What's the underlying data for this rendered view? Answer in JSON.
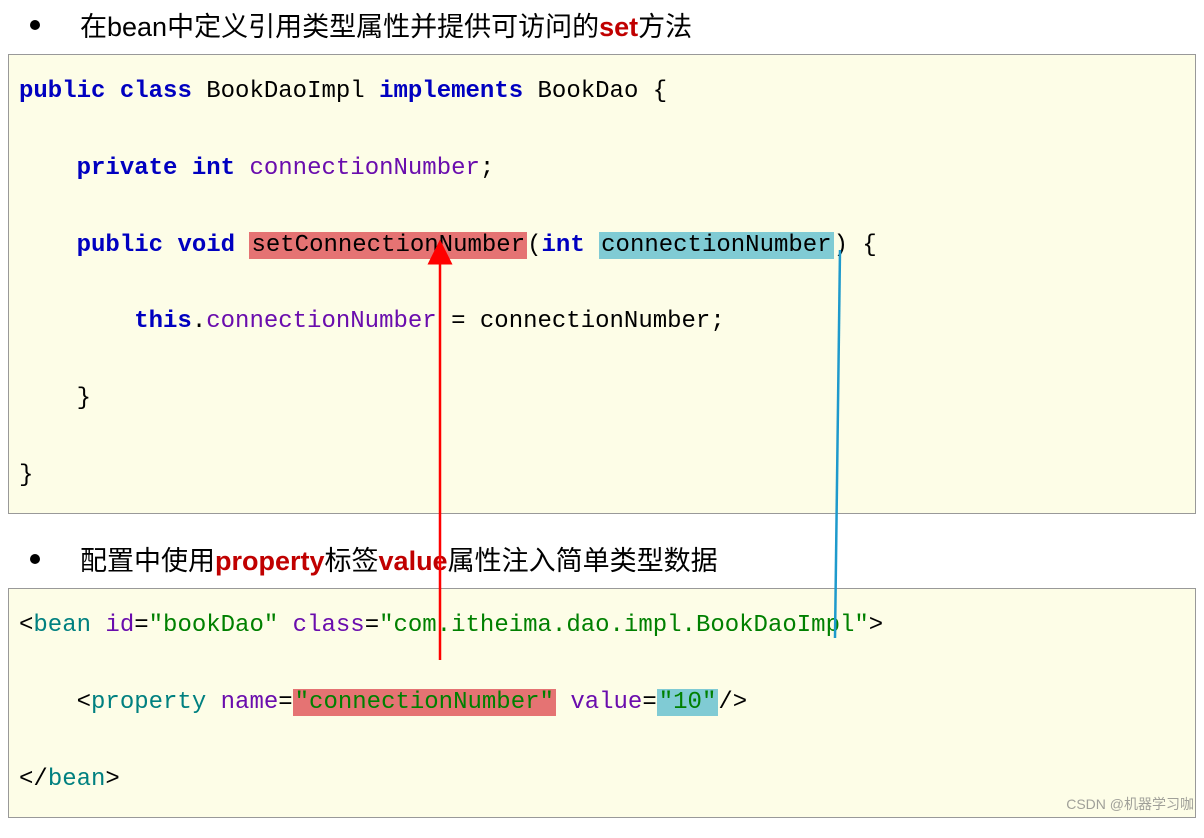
{
  "bullets": {
    "first_pre": "在bean中定义引用类型属性并提供可访问的",
    "first_red": "set",
    "first_post": "方法",
    "second_pre": "配置中使用",
    "second_red1": "property",
    "second_mid": "标签",
    "second_red2": "value",
    "second_post": "属性注入简单类型数据"
  },
  "java": {
    "public": "public",
    "class": "class",
    "className": "BookDaoImpl",
    "implements": "implements",
    "iface": "BookDao",
    "private": "private",
    "int": "int",
    "field": "connectionNumber",
    "void": "void",
    "method": "setConnectionNumber",
    "paramType": "int",
    "paramName": "connectionNumber",
    "this": "this",
    "assignField": "connectionNumber",
    "assignVal": "connectionNumber"
  },
  "xml": {
    "bean": "bean",
    "idAttr": "id",
    "idVal": "\"bookDao\"",
    "classAttr": "class",
    "classVal": "\"com.itheima.dao.impl.BookDaoImpl\"",
    "property": "property",
    "nameAttr": "name",
    "nameVal": "\"connectionNumber\"",
    "valueAttr": "value",
    "valueVal": "\"10\"",
    "beanClose": "bean"
  },
  "watermark": "CSDN @机器学习咖"
}
